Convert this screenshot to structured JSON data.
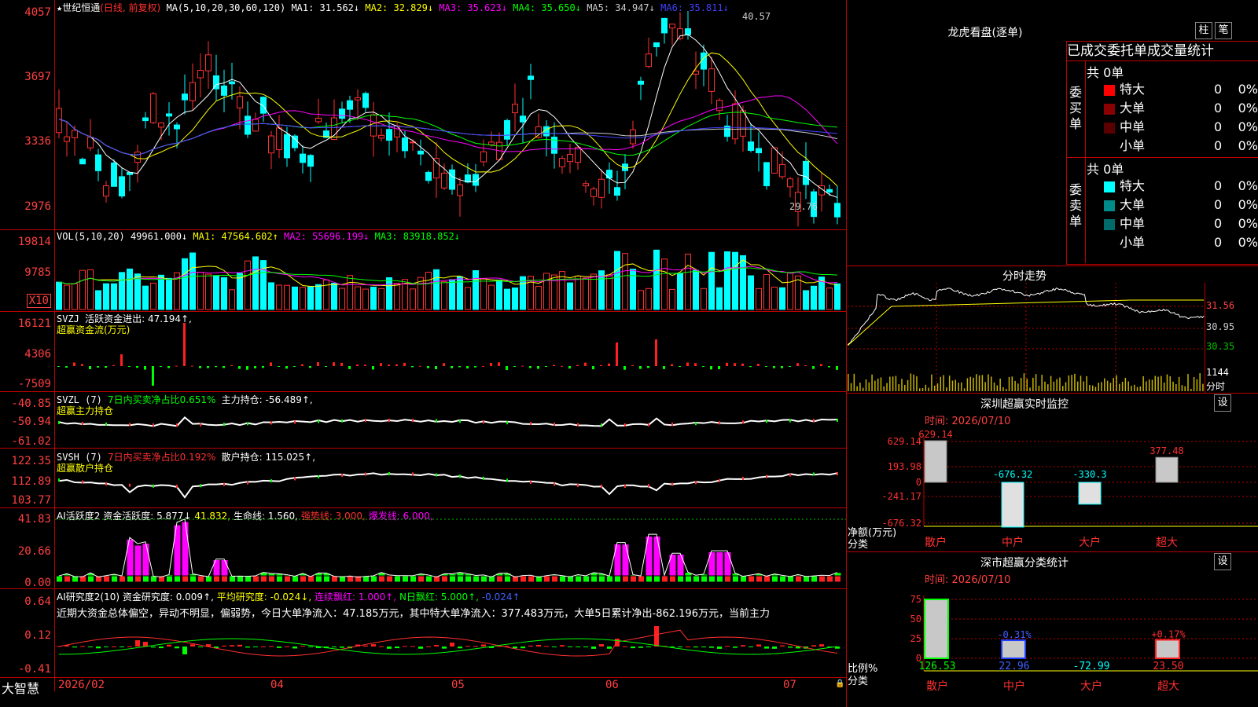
{
  "app": {
    "brand": "大智慧",
    "stock": "世纪恒通",
    "mode": "(日线, 前复权)"
  },
  "kline": {
    "ma_title": "MA(5,10,20,30,60,120)",
    "ma1": "MA1: 31.562↓",
    "ma2": "MA2: 32.829↓",
    "ma3": "MA3: 35.623↓",
    "ma4": "MA4: 35.650↓",
    "ma5": "MA5: 34.947↓",
    "ma6": "MA6: 35.811↓",
    "axis": [
      "4057",
      "3697",
      "3336",
      "2976"
    ],
    "high_label": "40.57",
    "low_label": "29.76"
  },
  "vol": {
    "title": "VOL(5,10,20)",
    "value": "49961.000↓",
    "ma1": "MA1: 47564.602↑",
    "ma2": "MA2: 55696.199↓",
    "ma3": "MA3: 83918.852↓",
    "axis": [
      "19814",
      "9785",
      "X10"
    ]
  },
  "svzj": {
    "title": "SVZJ",
    "label": "活跃资金进出: 47.194↑,",
    "sub": "超赢资金流(万元)",
    "axis": [
      "16121",
      "4306",
      "-7509"
    ]
  },
  "svzl": {
    "title": "SVZL (7)",
    "pct": "7日内买卖净占比0.651%",
    "label": "主力持仓: -56.489↑,",
    "sub": "超赢主力持仓",
    "axis": [
      "-40.85",
      "-50.94",
      "-61.02"
    ]
  },
  "svsh": {
    "title": "SVSH (7)",
    "pct": "7日内买卖净占比0.192%",
    "label": "散户持仓: 115.025↑,",
    "sub": "超赢散户持仓",
    "axis": [
      "122.35",
      "112.89",
      "103.77"
    ]
  },
  "ai1": {
    "title": "AI活跃度2",
    "l1": "资金活跃度: 5.877↓",
    "l2": "41.832,",
    "l3": "生命线: 1.560,",
    "l4": "强势线: 3.000,",
    "l5": "爆发线: 6.000,",
    "axis": [
      "41.83",
      "20.66",
      "0.00"
    ]
  },
  "ai2": {
    "title": "AI研究度2(10)",
    "l1": "资金研究度: 0.009↑,",
    "l2": "平均研究度: -0.024↓,",
    "l3": "连续飘红: 1.000↑,",
    "l4": "N日飘红: 5.000↑,",
    "l5": "-0.024↑",
    "comment": "近期大资金总体偏空，异动不明显，偏弱势，今日大单净流入：47.185万元，其中特大单净流入：377.483万元，大单5日累计净出-862.196万元，当前主力",
    "axis": [
      "0.64",
      "0.12",
      "-0.41"
    ]
  },
  "dates": [
    "2026/02",
    "04",
    "05",
    "06",
    "07"
  ],
  "lhb": {
    "title": "龙虎看盘(逐单)",
    "btn1": "柱",
    "btn2": "笔",
    "tabs": "已成交委托单成交量统计",
    "buy": {
      "side": "委买单",
      "total": "共 0单",
      "rows": [
        {
          "name": "特大",
          "v": "0",
          "p": "0%",
          "color": "#ff0000"
        },
        {
          "name": "大单",
          "v": "0",
          "p": "0%",
          "color": "#8b0000"
        },
        {
          "name": "中单",
          "v": "0",
          "p": "0%",
          "color": "#5a0000"
        },
        {
          "name": "小单",
          "v": "0",
          "p": "0%",
          "color": "#000000"
        }
      ]
    },
    "sell": {
      "side": "委卖单",
      "total": "共 0单",
      "rows": [
        {
          "name": "特大",
          "v": "0",
          "p": "0%",
          "color": "#00ffff"
        },
        {
          "name": "大单",
          "v": "0",
          "p": "0%",
          "color": "#008b8b"
        },
        {
          "name": "中单",
          "v": "0",
          "p": "0%",
          "color": "#006b6b"
        },
        {
          "name": "小单",
          "v": "0",
          "p": "0%",
          "color": "#000000"
        }
      ]
    }
  },
  "fenshi": {
    "title": "分时走势",
    "axis": [
      "31.56",
      "30.95",
      "30.35"
    ],
    "vol_axis": [
      "1144",
      "分时"
    ]
  },
  "monitor": {
    "title": "深圳超赢实时监控",
    "btn": "设",
    "time": "时间: 2026/07/10",
    "axis": [
      "629.14",
      "193.98",
      "0",
      "-241.17",
      "-676.32"
    ],
    "axis_label": "净额(万元)",
    "axis_label2": "分类",
    "bars": [
      {
        "cat": "散户",
        "val": "629.14"
      },
      {
        "cat": "中户",
        "val": "-676.32"
      },
      {
        "cat": "大户",
        "val": "-330.3"
      },
      {
        "cat": "超大",
        "val": "377.48"
      }
    ]
  },
  "classify": {
    "title": "深市超赢分类统计",
    "btn": "设",
    "time": "时间: 2026/07/10",
    "axis": [
      "75",
      "50",
      "25",
      "0"
    ],
    "axis_label": "比例%",
    "axis_label2": "分类",
    "bars": [
      {
        "cat": "散户",
        "val": "126.53",
        "pct": ""
      },
      {
        "cat": "中户",
        "val": "22.96",
        "pct": "-0.31%"
      },
      {
        "cat": "大户",
        "val": "-72.99",
        "pct": ""
      },
      {
        "cat": "超大",
        "val": "23.50",
        "pct": "+0.17%"
      }
    ]
  }
}
